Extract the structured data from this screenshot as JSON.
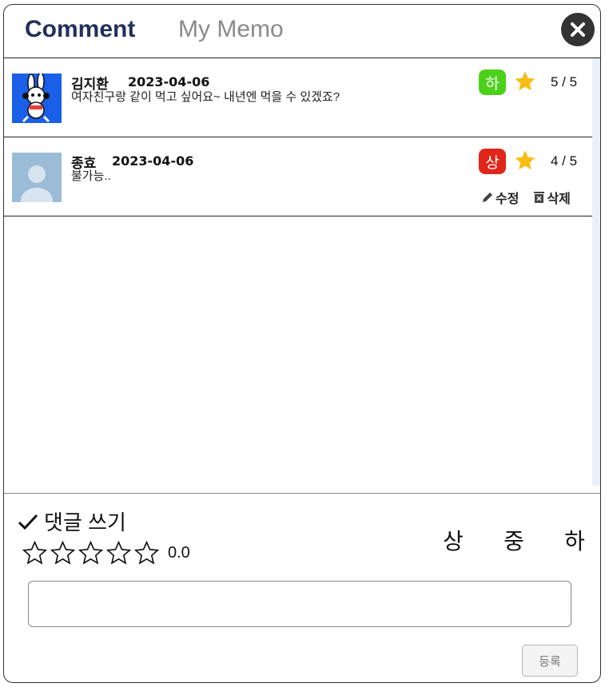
{
  "header": {
    "tabs": [
      {
        "label": "Comment",
        "active": true
      },
      {
        "label": "My Memo",
        "active": false
      }
    ],
    "close_icon": "close-icon"
  },
  "comments": [
    {
      "author": "김지환",
      "date": "2023-04-06",
      "text": "여자친구랑 같이 먹고 싶어요~ 내년엔 먹을 수 있겠죠?",
      "grade": "하",
      "grade_color": "#4cd11a",
      "rating": "5 / 5",
      "avatar_icon": "rabbit-character-avatar",
      "editable": false
    },
    {
      "author": "종효",
      "date": "2023-04-06",
      "text": "불가능..",
      "grade": "상",
      "grade_color": "#e0261b",
      "rating": "4 / 5",
      "avatar_icon": "default-user-avatar",
      "editable": true,
      "edit_label": "수정",
      "delete_label": "삭제"
    }
  ],
  "compose": {
    "title": "댓글 쓰기",
    "rating_value": "0.0",
    "grade_options": [
      "상",
      "중",
      "하"
    ],
    "input_value": "",
    "input_placeholder": "",
    "submit_label": "등록"
  },
  "colors": {
    "accent_title": "#22305c",
    "star": "#f7bd12"
  }
}
